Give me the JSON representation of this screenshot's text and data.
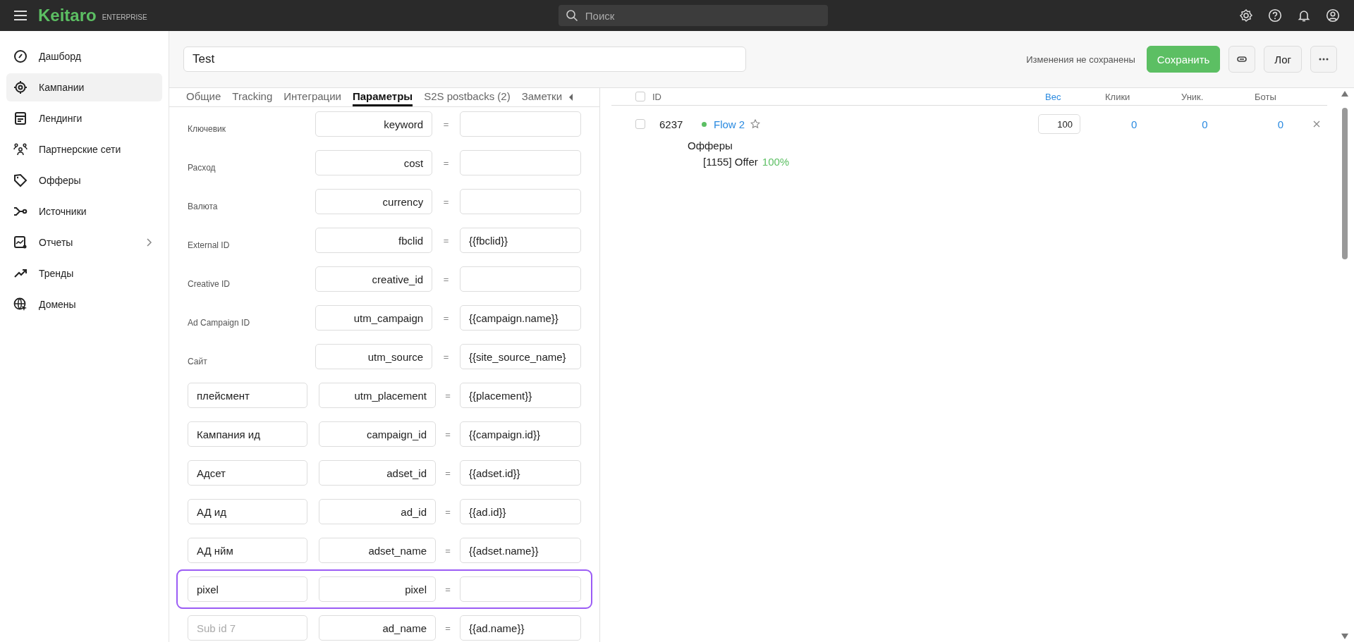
{
  "top_bar": {
    "logo": "Keitaro",
    "edition": "ENTERPRISE",
    "search": {
      "placeholder": "Поиск"
    }
  },
  "sidebar": {
    "items": [
      {
        "label": "Дашборд",
        "selected": false,
        "expandable": false
      },
      {
        "label": "Кампании",
        "selected": true,
        "expandable": false
      },
      {
        "label": "Лендинги",
        "selected": false,
        "expandable": false
      },
      {
        "label": "Партнерские сети",
        "selected": false,
        "expandable": false
      },
      {
        "label": "Офферы",
        "selected": false,
        "expandable": false
      },
      {
        "label": "Источники",
        "selected": false,
        "expandable": false
      },
      {
        "label": "Отчеты",
        "selected": false,
        "expandable": true
      },
      {
        "label": "Тренды",
        "selected": false,
        "expandable": false
      },
      {
        "label": "Домены",
        "selected": false,
        "expandable": false
      }
    ]
  },
  "campaign": {
    "name": "Test",
    "status": "Изменения не сохранены",
    "save_button": "Сохранить",
    "log_button": "Лог"
  },
  "tabs": [
    {
      "label": "Общие",
      "selected": false
    },
    {
      "label": "Tracking",
      "selected": false
    },
    {
      "label": "Интеграции",
      "selected": false
    },
    {
      "label": "Параметры",
      "selected": true
    },
    {
      "label": "S2S postbacks (2)",
      "selected": false
    },
    {
      "label": "Заметки",
      "selected": false
    }
  ],
  "parameters": [
    {
      "name": {
        "kind": "label",
        "text": "Ключевик"
      },
      "param": "keyword",
      "highlighted": false
    },
    {
      "name": {
        "kind": "label",
        "text": "Расход"
      },
      "param": "cost",
      "highlighted": false
    },
    {
      "name": {
        "kind": "label",
        "text": "Валюта"
      },
      "param": "currency",
      "highlighted": false
    },
    {
      "name": {
        "kind": "label",
        "text": "External ID"
      },
      "param": "fbclid",
      "value": "{{fbclid}}",
      "highlighted": false
    },
    {
      "name": {
        "kind": "label",
        "text": "Creative ID"
      },
      "param": "creative_id",
      "highlighted": false
    },
    {
      "name": {
        "kind": "label",
        "text": "Ad Campaign ID"
      },
      "param": "utm_campaign",
      "value": "{{campaign.name}}",
      "highlighted": false
    },
    {
      "name": {
        "kind": "label",
        "text": "Сайт"
      },
      "param": "utm_source",
      "value": "{{site_source_name}",
      "highlighted": false
    },
    {
      "name": {
        "kind": "input",
        "text": "плейсмент"
      },
      "param": "utm_placement",
      "value": "{{placement}}",
      "highlighted": false
    },
    {
      "name": {
        "kind": "input",
        "text": "Кампания ид"
      },
      "param": "campaign_id",
      "value": "{{campaign.id}}",
      "highlighted": false
    },
    {
      "name": {
        "kind": "input",
        "text": "Адсет"
      },
      "param": "adset_id",
      "value": "{{adset.id}}",
      "highlighted": false
    },
    {
      "name": {
        "kind": "input",
        "text": "АД ид"
      },
      "param": "ad_id",
      "value": "{{ad.id}}",
      "highlighted": false
    },
    {
      "name": {
        "kind": "input",
        "text": "АД нйм"
      },
      "param": "adset_name",
      "value": "{{adset.name}}",
      "highlighted": false
    },
    {
      "name": {
        "kind": "input",
        "text": "pixel"
      },
      "param": "pixel",
      "highlighted": true
    },
    {
      "name": {
        "kind": "placeholder",
        "placeholder": "Sub id 7"
      },
      "param": "ad_name",
      "value": "{{ad.name}}",
      "highlighted": false
    }
  ],
  "operator": "=",
  "flows": {
    "all_selected": false,
    "columns": [
      {
        "label": "ID",
        "sorted": false
      },
      {
        "label": "Вес",
        "sorted": true
      },
      {
        "label": "Клики",
        "sorted": false
      },
      {
        "label": "Уник.",
        "sorted": false
      },
      {
        "label": "Боты",
        "sorted": false
      }
    ],
    "rows": [
      {
        "selected": false,
        "id": "6237",
        "active": true,
        "name": "Flow 2",
        "favorite": false,
        "weight": "100",
        "clicks": "0",
        "unique": "0",
        "bots": "0",
        "offers_label": "Офферы",
        "offers": [
          {
            "name": "[1155] Offer",
            "share": "100%"
          }
        ]
      }
    ]
  }
}
